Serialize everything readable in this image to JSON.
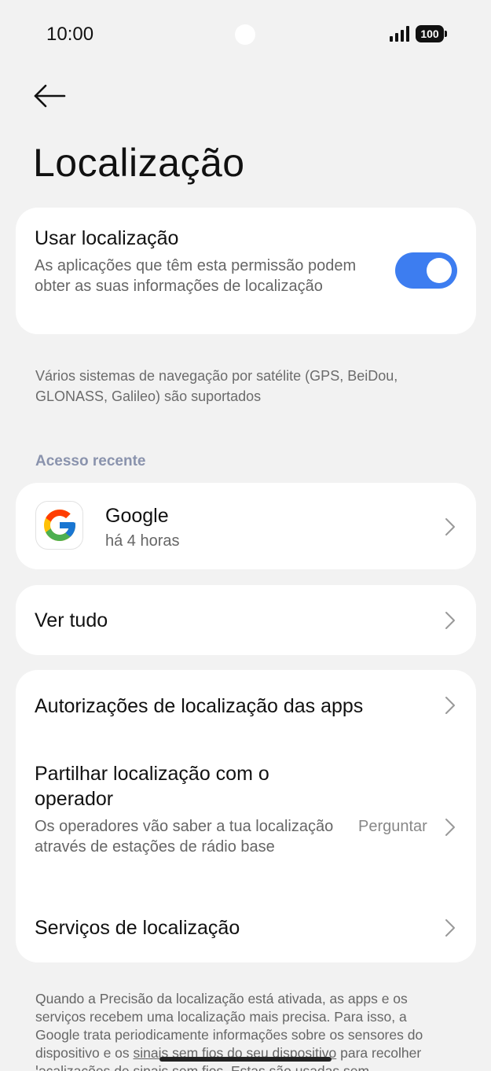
{
  "status_bar": {
    "time": "10:00",
    "battery": "100"
  },
  "header": {
    "title": "Localização"
  },
  "use_location": {
    "title": "Usar localização",
    "description": "As aplicações que têm esta permissão podem obter as suas informações de localização",
    "enabled": true
  },
  "gnss_note": "Vários sistemas de navegação por satélite (GPS, BeiDou, GLONASS, Galileo) são suportados",
  "recent_access": {
    "header": "Acesso recente",
    "items": [
      {
        "app_name": "Google",
        "time": "há 4 horas",
        "icon": "google-logo-icon"
      }
    ]
  },
  "see_all": {
    "label": "Ver tudo"
  },
  "settings": {
    "app_permissions": "Autorizações de localização das apps",
    "share_with_operator": {
      "title": "Partilhar localização com o operador",
      "description": "Os operadores vão saber a tua localização através de estações de rádio base",
      "value": "Perguntar"
    },
    "location_services": "Serviços de localização"
  },
  "footer": {
    "text_before": "Quando a Precisão da localização está ativada, as apps e os serviços recebem uma localização mais precisa. Para isso, a Google trata periodicamente informações sobre os sensores do dispositivo e os ",
    "link": "sinais sem fios do seu dispositivo",
    "text_after": " para recolher localizações de sinais sem fios. Estas são usadas sem"
  },
  "colors": {
    "accent": "#3d7df0",
    "background": "#f2f2f2",
    "card": "#ffffff",
    "section_header": "#8a93ad"
  }
}
